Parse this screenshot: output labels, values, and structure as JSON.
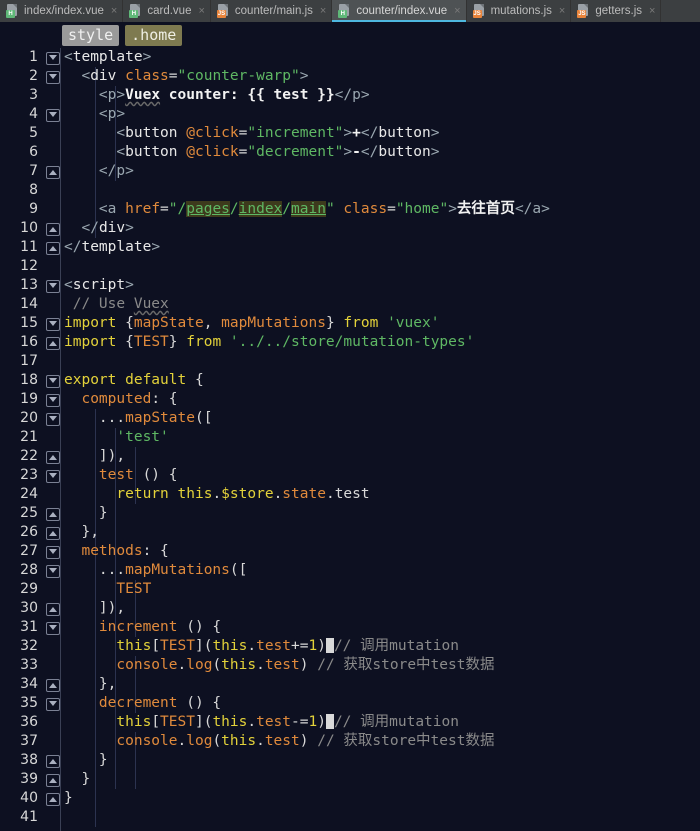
{
  "window": {
    "app": "code-editor",
    "theme_bg": "#0d1021",
    "accent": "#4eb8e0"
  },
  "tabs": [
    {
      "label": "index/index.vue",
      "icon": "vue-file-icon",
      "type": "vue",
      "badge": "H",
      "active": false,
      "close": "×"
    },
    {
      "label": "card.vue",
      "icon": "vue-file-icon",
      "type": "vue",
      "badge": "H",
      "active": false,
      "close": "×"
    },
    {
      "label": "counter/main.js",
      "icon": "js-file-icon",
      "type": "js",
      "badge": "JS",
      "active": false,
      "close": "×"
    },
    {
      "label": "counter/index.vue",
      "icon": "vue-file-icon",
      "type": "vue",
      "badge": "H",
      "active": true,
      "close": "×"
    },
    {
      "label": "mutations.js",
      "icon": "js-file-icon",
      "type": "js",
      "badge": "JS",
      "active": false,
      "close": "×"
    },
    {
      "label": "getters.js",
      "icon": "js-file-icon",
      "type": "js",
      "badge": "JS",
      "active": false,
      "close": "×"
    }
  ],
  "breadcrumb": {
    "items": [
      {
        "label": "style",
        "style": "style"
      },
      {
        "label": ".home",
        "style": "home"
      }
    ]
  },
  "editor": {
    "first_line": 1,
    "last_line": 41,
    "line_numbers": [
      "1",
      "2",
      "3",
      "4",
      "5",
      "6",
      "7",
      "8",
      "9",
      "10",
      "11",
      "12",
      "13",
      "14",
      "15",
      "16",
      "17",
      "18",
      "19",
      "20",
      "21",
      "22",
      "23",
      "24",
      "25",
      "26",
      "27",
      "28",
      "29",
      "30",
      "31",
      "32",
      "33",
      "34",
      "35",
      "36",
      "37",
      "38",
      "39",
      "40",
      "41"
    ],
    "lines": [
      {
        "n": "1",
        "fold": "open",
        "code": "<template>"
      },
      {
        "n": "2",
        "fold": "open",
        "code": "  <div class=\"counter-warp\">"
      },
      {
        "n": "3",
        "fold": "",
        "code": "    <p>Vuex counter: {{ test }}</p>"
      },
      {
        "n": "4",
        "fold": "open",
        "code": "    <p>"
      },
      {
        "n": "5",
        "fold": "",
        "code": "      <button @click=\"increment\">+</button>"
      },
      {
        "n": "6",
        "fold": "",
        "code": "      <button @click=\"decrement\">-</button>"
      },
      {
        "n": "7",
        "fold": "close",
        "code": "    </p>"
      },
      {
        "n": "8",
        "fold": "",
        "code": ""
      },
      {
        "n": "9",
        "fold": "",
        "code": "    <a href=\"/pages/index/main\" class=\"home\">去往首页</a>"
      },
      {
        "n": "10",
        "fold": "close",
        "code": "  </div>"
      },
      {
        "n": "11",
        "fold": "close",
        "code": "</template>"
      },
      {
        "n": "12",
        "fold": "",
        "code": ""
      },
      {
        "n": "13",
        "fold": "open",
        "code": "<script>"
      },
      {
        "n": "14",
        "fold": "",
        "code": " // Use Vuex"
      },
      {
        "n": "15",
        "fold": "open",
        "code": "import {mapState, mapMutations} from 'vuex'"
      },
      {
        "n": "16",
        "fold": "close",
        "code": "import {TEST} from '../../store/mutation-types'"
      },
      {
        "n": "17",
        "fold": "",
        "code": ""
      },
      {
        "n": "18",
        "fold": "open",
        "code": "export default {"
      },
      {
        "n": "19",
        "fold": "open",
        "code": "  computed: {"
      },
      {
        "n": "20",
        "fold": "open",
        "code": "    ...mapState(["
      },
      {
        "n": "21",
        "fold": "",
        "code": "      'test'"
      },
      {
        "n": "22",
        "fold": "close",
        "code": "    ]),"
      },
      {
        "n": "23",
        "fold": "open",
        "code": "    test () {"
      },
      {
        "n": "24",
        "fold": "",
        "code": "      return this.$store.state.test"
      },
      {
        "n": "25",
        "fold": "close",
        "code": "    }"
      },
      {
        "n": "26",
        "fold": "close",
        "code": "  },"
      },
      {
        "n": "27",
        "fold": "open",
        "code": "  methods: {"
      },
      {
        "n": "28",
        "fold": "open",
        "code": "    ...mapMutations(["
      },
      {
        "n": "29",
        "fold": "",
        "code": "      TEST"
      },
      {
        "n": "30",
        "fold": "close",
        "code": "    ]),"
      },
      {
        "n": "31",
        "fold": "open",
        "code": "    increment () {"
      },
      {
        "n": "32",
        "fold": "",
        "code": "      this[TEST](this.test+=1) // 调用mutation"
      },
      {
        "n": "33",
        "fold": "",
        "code": "      console.log(this.test) // 获取store中test数据"
      },
      {
        "n": "34",
        "fold": "close",
        "code": "    },"
      },
      {
        "n": "35",
        "fold": "open",
        "code": "    decrement () {"
      },
      {
        "n": "36",
        "fold": "",
        "code": "      this[TEST](this.test-=1) // 调用mutation"
      },
      {
        "n": "37",
        "fold": "",
        "code": "      console.log(this.test) // 获取store中test数据"
      },
      {
        "n": "38",
        "fold": "close",
        "code": "    }"
      },
      {
        "n": "39",
        "fold": "close",
        "code": "  }"
      },
      {
        "n": "40",
        "fold": "close",
        "code": "}"
      },
      {
        "n": "41",
        "fold": "",
        "code": ""
      }
    ],
    "cursor_lines": [
      "32",
      "36"
    ],
    "link_segments": [
      "pages",
      "index",
      "main"
    ],
    "comments": {
      "call_mutation": "// 调用mutation",
      "get_store_test": "// 获取store中test数据"
    },
    "strings": {
      "counter_warp": "counter-warp",
      "increment": "increment",
      "decrement": "decrement",
      "home": "home",
      "vuex": "'vuex'",
      "mutation_types": "'../../store/mutation-types'",
      "test_quoted": "'test'"
    },
    "link_text": "去往首页",
    "interpolation": "Vuex counter: {{ test }}"
  }
}
